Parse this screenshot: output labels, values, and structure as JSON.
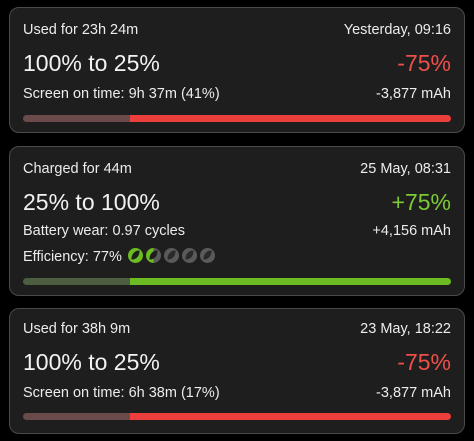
{
  "cards": [
    {
      "title": "Used for 23h 24m",
      "time": "Yesterday, 09:16",
      "range": "100% to 25%",
      "delta": "-75%",
      "detail": "Screen on time: 9h 37m (41%)",
      "mah": "-3,877 mAh",
      "bar": {
        "from_percent": 100,
        "to_percent": 25,
        "dim_color": "#6a4a4a",
        "fill_color": "#ec3f3b"
      }
    },
    {
      "title": "Charged for 44m",
      "time": "25 May, 08:31",
      "range": "25% to 100%",
      "delta": "+75%",
      "detail": "Battery wear: 0.97 cycles",
      "mah": "+4,156 mAh",
      "efficiency_label": "Efficiency: 77%",
      "efficiency_icons": [
        "leaf-full-icon",
        "leaf-half-icon",
        "leaf-empty-icon",
        "leaf-empty-icon",
        "leaf-empty-icon"
      ],
      "bar": {
        "from_percent": 25,
        "to_percent": 100,
        "dim_color": "#4d5e40",
        "fill_color": "#6cbb22"
      }
    },
    {
      "title": "Used for 38h 9m",
      "time": "23 May, 18:22",
      "range": "100% to 25%",
      "delta": "-75%",
      "detail": "Screen on time: 6h 38m (17%)",
      "mah": "-3,877 mAh",
      "bar": {
        "from_percent": 100,
        "to_percent": 25,
        "dim_color": "#6a4a4a",
        "fill_color": "#ec3f3b"
      }
    }
  ],
  "colors": {
    "background": "#000000",
    "card": "#1e1e1e",
    "negative": "#ef4f4a",
    "positive": "#7ccb35"
  }
}
